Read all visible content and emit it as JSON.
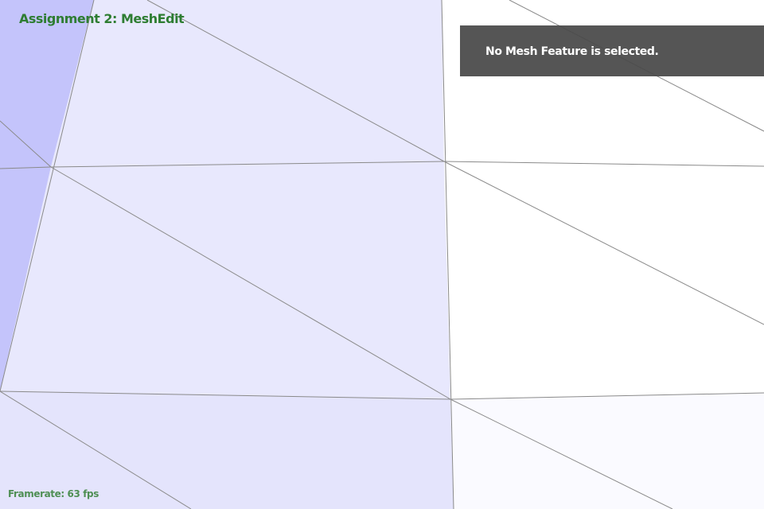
{
  "app": {
    "title": "Assignment 2: MeshEdit"
  },
  "status": {
    "framerate_label": "Framerate: 63 fps"
  },
  "selection_panel": {
    "message": "No Mesh Feature is selected."
  },
  "colors": {
    "title_green": "#2e7d32",
    "framerate_green": "#4f8f54",
    "panel_bg": "#484848",
    "face_lavender_light": "#e8e8fd",
    "face_lavender_mid": "#e4e4fc",
    "face_lavender_dark": "#c4c4fb",
    "face_white": "#ffffff",
    "face_near_white": "#fafaff",
    "edge_gray": "#8a8a8a"
  }
}
